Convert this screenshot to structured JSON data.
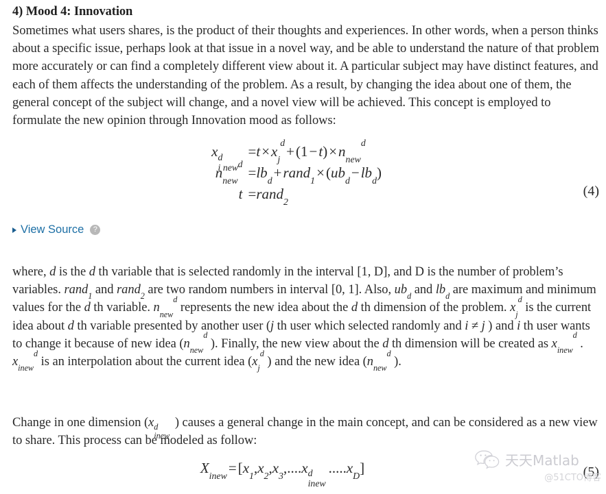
{
  "document": {
    "background_color": "#ffffff",
    "text_color": "#2a2a2a",
    "link_color": "#1d6fa5"
  },
  "section": {
    "heading": "4) Mood 4: Innovation",
    "intro_paragraph": "Sometimes what users shares, is the product of their thoughts and experiences. In other words, when a person thinks about a specific issue, perhaps look at that issue in a novel way, and be able to understand the nature of that problem more accurately or can find a completely different view about it. A particular subject may have distinct features, and each of them affects the understanding of the problem. As a result, by changing the idea about one of them, the general concept of the subject will change, and a novel view will be achieved. This concept is employed to formulate the new opinion through Innovation mood as follows:"
  },
  "equation4": {
    "number": "(4)",
    "lines": [
      {
        "lhs_base": "x",
        "lhs_sup": "d",
        "lhs_sub": "i new",
        "rel": "=",
        "rhs": "t × xⱼᵈ + (1 − t) × nᵈₙₑᵥ"
      },
      {
        "lhs_base": "n",
        "lhs_sup": "d",
        "lhs_sub": "new",
        "rel": "=",
        "rhs": "lbᵈ + rand₁ × (ubᵈ − lbᵈ)"
      },
      {
        "lhs_base": "t",
        "lhs_sup": "",
        "lhs_sub": "",
        "rel": "=",
        "rhs": "rand₂"
      }
    ],
    "tokens": {
      "t": "t",
      "times": "×",
      "plus": "+",
      "minus": "−",
      "equals": "=",
      "paren_open": "(",
      "paren_close": ")",
      "one": "1",
      "x": "x",
      "n": "n",
      "d": "d",
      "j": "j",
      "new": "new",
      "i_new": "i new",
      "lb": "lb",
      "ub": "ub",
      "rand": "rand",
      "sub_1": "1",
      "sub_2": "2"
    }
  },
  "view_source": {
    "label": "View Source",
    "triangle_icon": "triangle-right-icon",
    "help_icon": "help-question-icon",
    "help_glyph": "?"
  },
  "paragraph_where": {
    "segments": [
      "where, ",
      "d",
      " is the ",
      "d",
      " th variable that is selected randomly in the interval [1, D], and D is the number of problem’s variables. ",
      "rand₁",
      " and ",
      "rand₂",
      " are two random numbers in interval [0, 1]. Also, ",
      "ubᵈ",
      " and ",
      "lbᵈ",
      " are maximum and minimum values for the ",
      "d",
      " th variable. ",
      "nᵈₙₑᵥ",
      " represents the new idea about the ",
      "d",
      " th dimension of the problem. ",
      "xⱼᵈ",
      " is the current idea about ",
      "d",
      " th variable presented by another user (",
      "j",
      " th user which selected randomly and ",
      "i ≠ j",
      " ) and ",
      "i",
      " th user wants to change it because of new idea (",
      "nᵈₙₑᵥ",
      " ). Finally, the new view about the ",
      "d",
      " th dimension will be created as ",
      "xᵈᵢₙₑᵥ",
      " . ",
      "xᵈᵢₙₑᵥ",
      " is an interpolation about the current idea (",
      "xⱼᵈ",
      " ) and the new idea (",
      "nᵈₙₑᵥ",
      " )."
    ],
    "plain_text": "where, d is the d th variable that is selected randomly in the interval [1, D], and D is the number of problem’s variables. rand1 and rand2 are two random numbers in interval [0, 1]. Also, ubd and lbd are maximum and minimum values for the d th variable. ndnew represents the new idea about the d th dimension of the problem. xdj is the current idea about d th variable presented by another user (j th user which selected randomly and i ≠ j ) and i th user wants to change it because of new idea (ndnew ). Finally, the new view about the d th dimension will be created as xdinew . xdinew is an interpolation about the current idea (xdj ) and the new idea (ndnew ).",
    "text_parts": {
      "p1": "where, ",
      "p2": " is the ",
      "p3": " th variable that is selected randomly in the interval [1, D], and D is the number of problem’s variables. ",
      "p4": " and ",
      "p5": " are two random numbers in interval [0, 1]. Also, ",
      "p6": " and ",
      "p7": " are maximum and minimum values for the ",
      "p8": " th variable. ",
      "p9": " represents the new idea about the ",
      "p10": " th dimension of the problem. ",
      "p11": " is the current idea about ",
      "p12": " th variable presented by another user (",
      "p13": " th user which selected randomly and ",
      "p14": " ) and ",
      "p15": " th user wants to change it because of new idea (",
      "p16": " ). Finally, the new view about the ",
      "p17": " th dimension will be created as ",
      "p18": " . ",
      "p19": " is an interpolation about the current idea (",
      "p20": " ) and the new idea (",
      "p21": " )."
    }
  },
  "paragraph_change": {
    "text_parts": {
      "p1": "Change in one dimension (",
      "p2": " ) causes a general change in the main concept, and can be considered as a new view to share. This process can be modeled as follow:"
    },
    "plain_text": "Change in one dimension (xdinew ) causes a general change in the main concept, and can be considered as a new view to share. This process can be modeled as follow:"
  },
  "equation5": {
    "number": "(5)",
    "plain_text": "X_inew = [x1, x2, x3, .... x^d_inew ..... xD]",
    "tokens": {
      "X": "X",
      "inew": "inew",
      "equals": "=",
      "bracket_open": "[",
      "bracket_close": "]",
      "x": "x",
      "comma": ",",
      "dots4": "....",
      "dots5": ".....",
      "sub_1": "1",
      "sub_2": "2",
      "sub_3": "3",
      "sup_d": "d",
      "sub_D": "D"
    }
  },
  "watermark": {
    "icon_name": "wechat-icon",
    "brand": "天天Matlab",
    "handle": "@51CTO博客",
    "color": "#c9c9cf"
  }
}
